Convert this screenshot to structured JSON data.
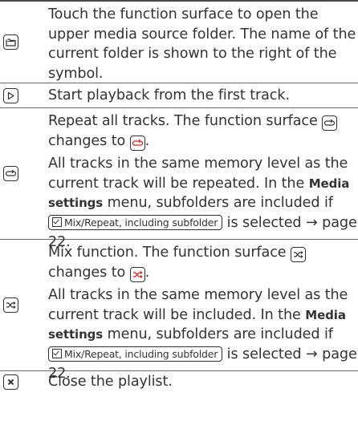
{
  "colors": {
    "text": "#333333",
    "accent_red": "#e2231a",
    "rule": "#6a6a6a"
  },
  "rows": [
    {
      "icon": "folder-up-icon",
      "text": "Touch the function surface to open the upper media source folder. The name of the current folder is shown to the right of the symbol."
    },
    {
      "icon": "play-icon",
      "text": "Start playback from the first track."
    },
    {
      "icon": "repeat-icon",
      "p1_a": "Repeat all tracks. The function surface",
      "p1_b": "changes to",
      "p1_c": ".",
      "p2_a": "All tracks in the same memory level as the current track will be repeated. In the",
      "menu_name": "Media settings",
      "p2_b": "menu, subfolders are included if",
      "option_label": "Mix/Repeat, including subfolder",
      "p2_c": "is selected",
      "page_ref": "→ page 22."
    },
    {
      "icon": "shuffle-icon",
      "p1_a": "Mix function. The function surface",
      "p1_b": "changes to",
      "p1_c": ".",
      "p2_a": "All tracks in the same memory level as the current track will be included. In the",
      "menu_name": "Media settings",
      "p2_b": "menu, subfolders are included if",
      "option_label": "Mix/Repeat, including subfolder",
      "p2_c": "is selected",
      "page_ref": "→ page 22."
    },
    {
      "icon": "close-icon",
      "text": "Close the playlist."
    }
  ]
}
